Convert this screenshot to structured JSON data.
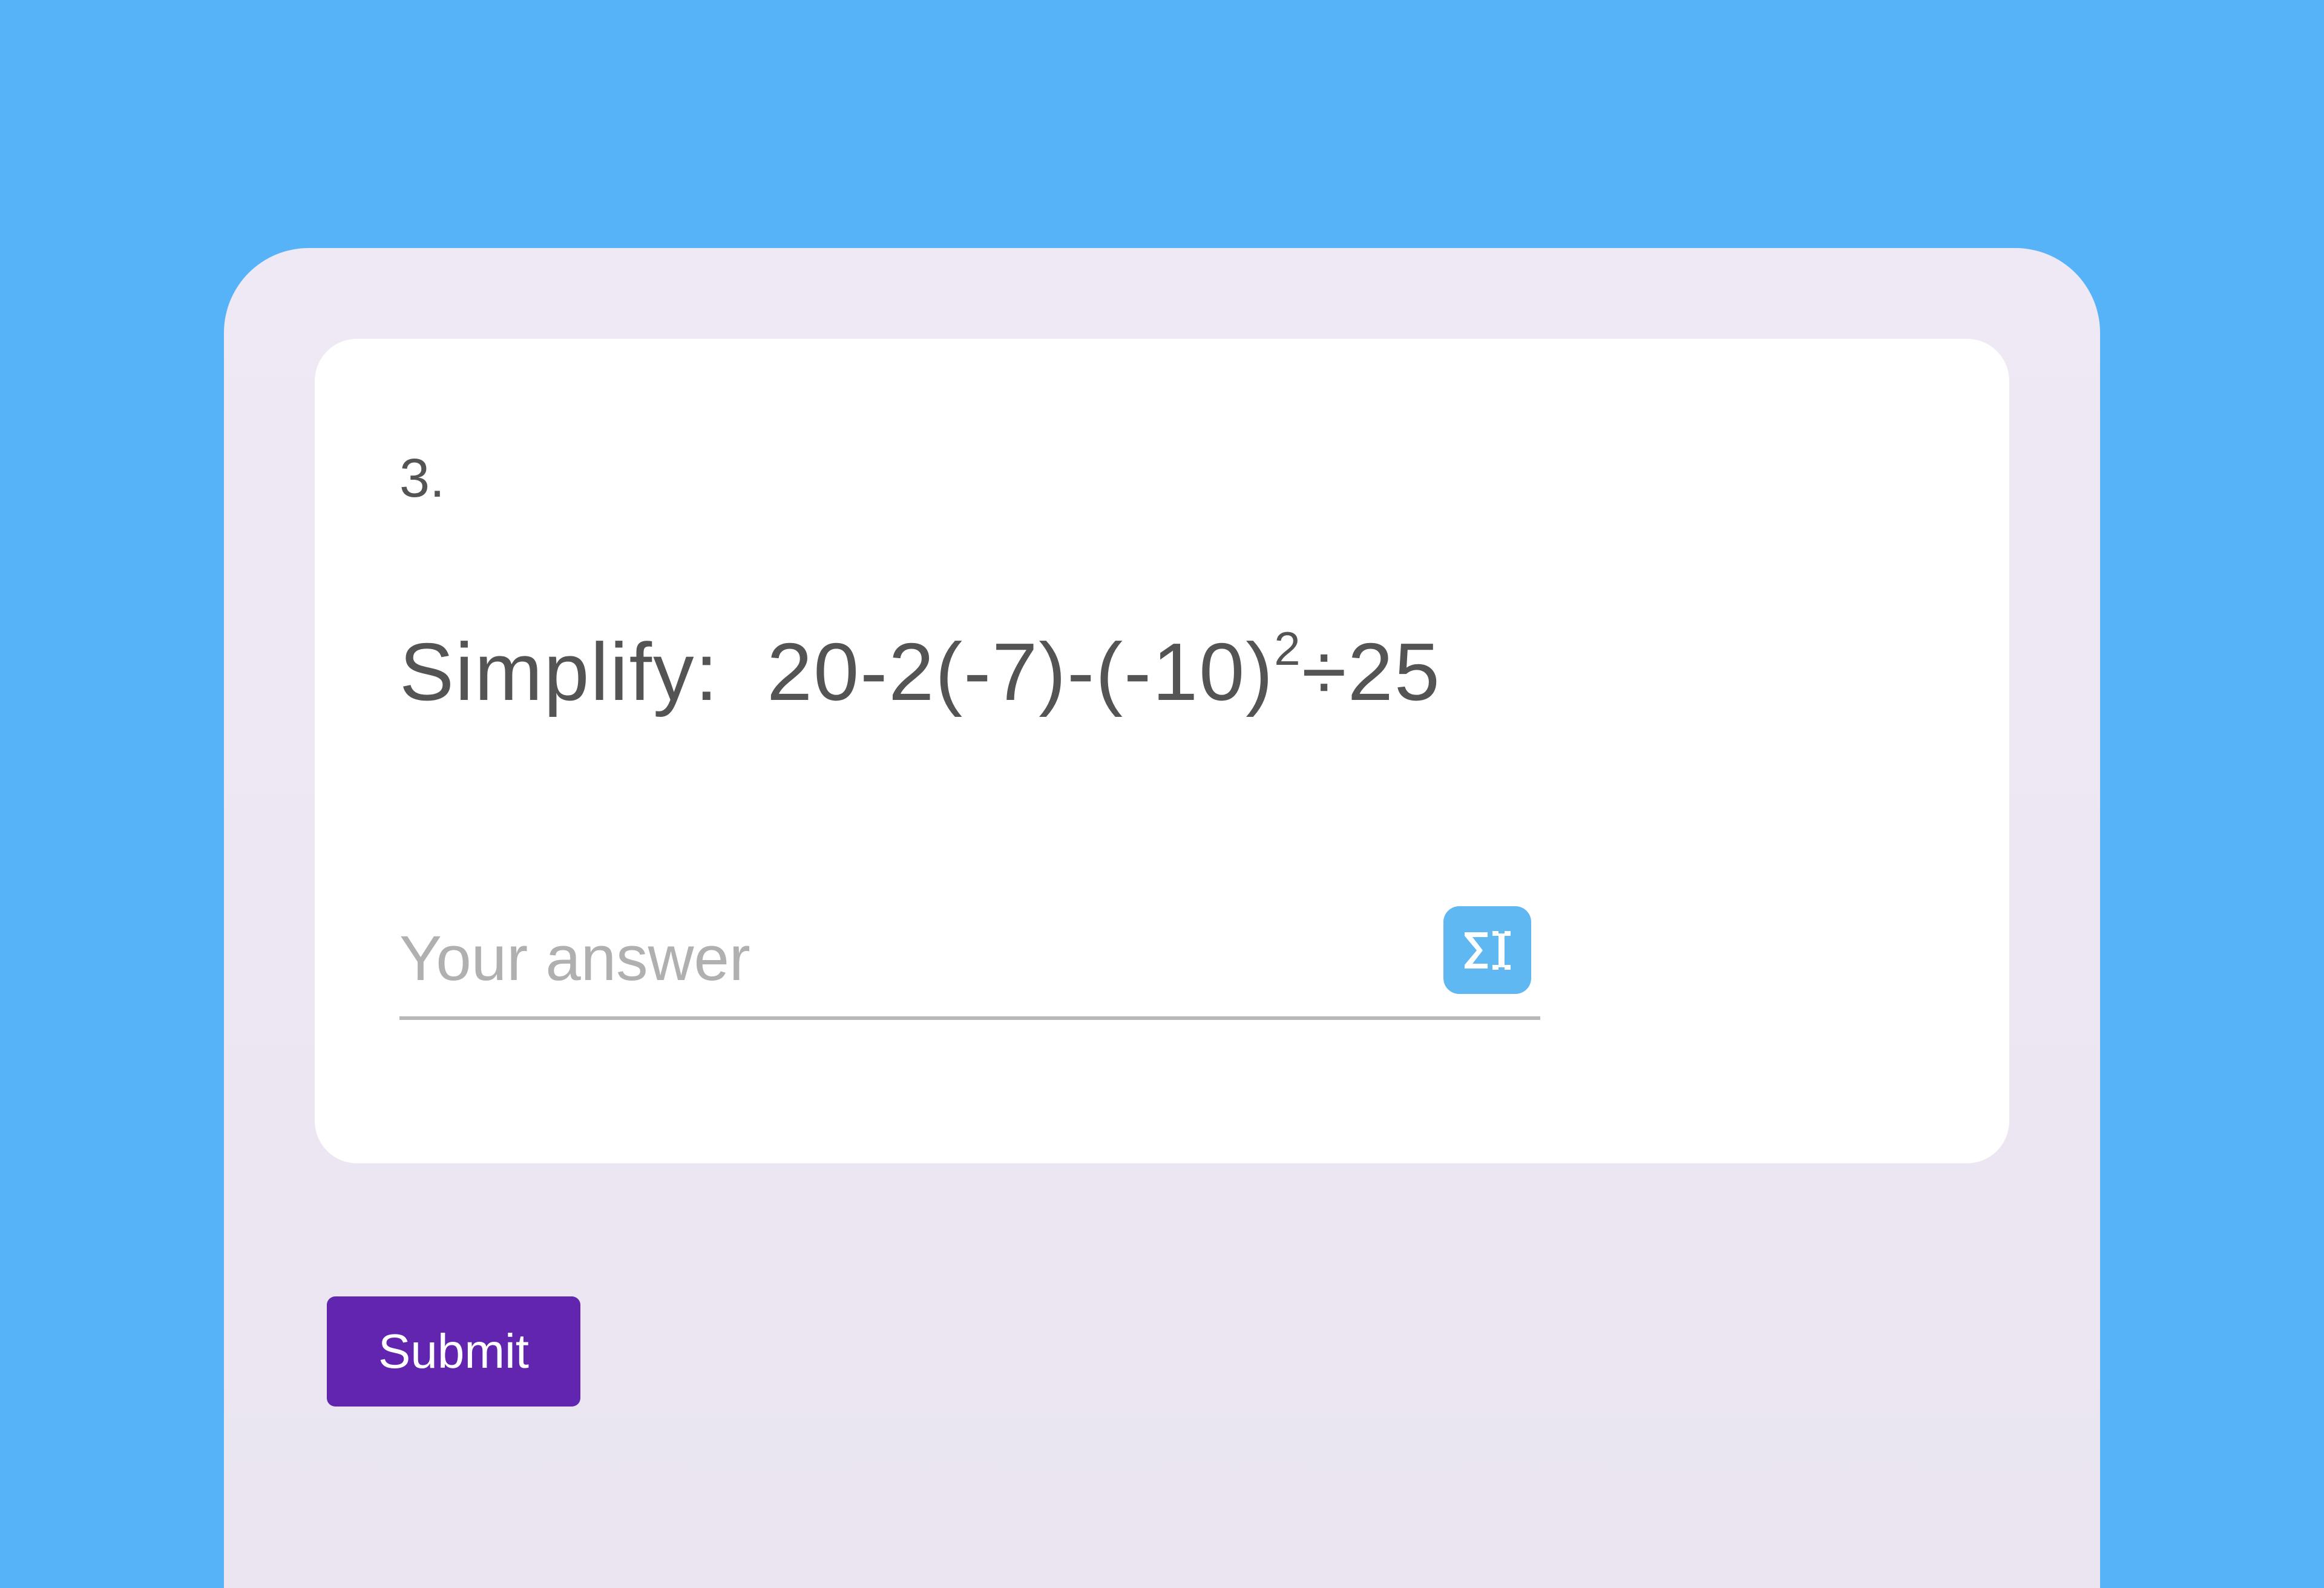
{
  "question": {
    "number": "3.",
    "prompt_label": "Simplify:",
    "expression_base1": "20-2(-7)-(-10)",
    "expression_exponent": "2",
    "expression_base2": "÷25"
  },
  "answer": {
    "placeholder": "Your answer",
    "value": ""
  },
  "equation_editor": {
    "icon_name": "sigma-cursor-icon"
  },
  "submit_label": "Submit",
  "colors": {
    "background": "#57b3f7",
    "form_bg": "#efe9f5",
    "card_bg": "#ffffff",
    "text": "#545454",
    "placeholder": "#b0b0b0",
    "equation_btn": "#5fb8f2",
    "submit_btn": "#6125b0"
  }
}
